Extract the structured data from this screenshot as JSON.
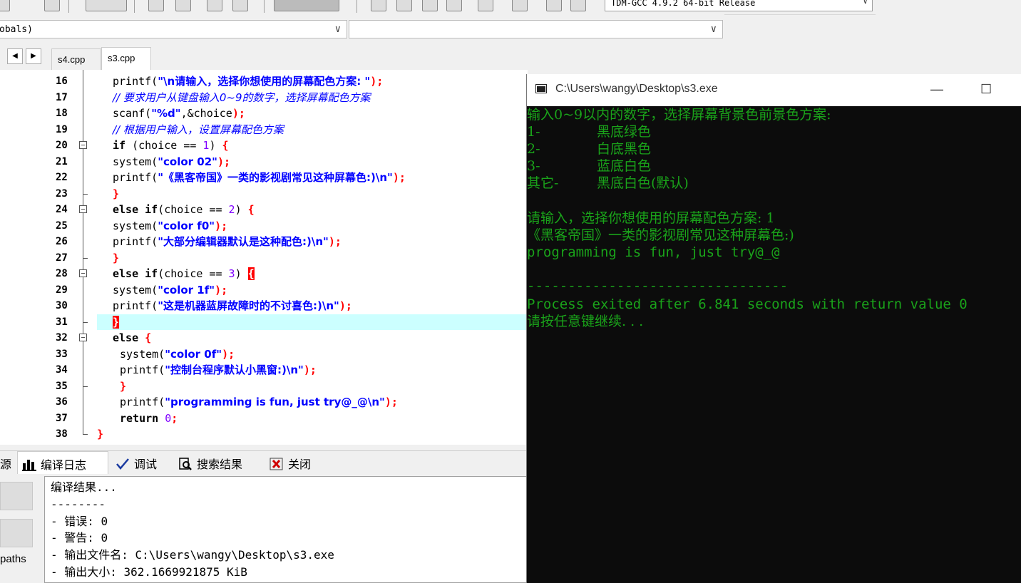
{
  "toolbar": {
    "compiler": "TDM-GCC 4.9.2 64-bit Release"
  },
  "scope": {
    "globals": "obals)",
    "members": ""
  },
  "tabs": [
    {
      "label": "s4.cpp",
      "active": false
    },
    {
      "label": "s3.cpp",
      "active": true
    }
  ],
  "editor": {
    "line_numbers": [
      "16",
      "17",
      "18",
      "19",
      "20",
      "21",
      "22",
      "23",
      "24",
      "25",
      "26",
      "27",
      "28",
      "29",
      "30",
      "31",
      "32",
      "33",
      "34",
      "35",
      "36",
      "37",
      "38"
    ],
    "lines": {
      "l16": {
        "fn": "printf(",
        "str": "\"\\n请输入，选择你想使用的屏幕配色方案: \"",
        "end": ");"
      },
      "l17": "// 要求用户从键盘输入0~9的数字，选择屏幕配色方案",
      "l18": {
        "fn": "scanf(",
        "str": "\"%d\"",
        "mid": ",&choice",
        "end": ");"
      },
      "l19": "// 根据用户输入，设置屏幕配色方案",
      "l20": {
        "kw": "if",
        "a": " (choice ",
        "op": "==",
        "num": " 1",
        "b": ") ",
        "brace": "{"
      },
      "l21": {
        "fn": "system(",
        "str": "\"color 02\"",
        "end": ");"
      },
      "l22": {
        "fn": "printf(",
        "str": "\"《黑客帝国》一类的影视剧常见这种屏幕色:)\\n\"",
        "end": ");"
      },
      "l23": "}",
      "l24": {
        "kw": "else if",
        "a": "(choice ",
        "op": "==",
        "num": " 2",
        "b": ") ",
        "brace": "{"
      },
      "l25": {
        "fn": "system(",
        "str": "\"color f0\"",
        "end": ");"
      },
      "l26": {
        "fn": "printf(",
        "str": "\"大部分编辑器默认是这种配色:)\\n\"",
        "end": ");"
      },
      "l27": "}",
      "l28": {
        "kw": "else if",
        "a": "(choice ",
        "op": "==",
        "num": " 3",
        "b": ") ",
        "brace": "{"
      },
      "l29": {
        "fn": "system(",
        "str": "\"color 1f\"",
        "end": ");"
      },
      "l30": {
        "fn": "printf(",
        "str": "\"这是机器蓝屏故障时的不讨喜色:)\\n\"",
        "end": ");"
      },
      "l31": "}",
      "l32": {
        "kw": "else",
        "brace": " {"
      },
      "l33": {
        "fn": "system(",
        "str": "\"color 0f\"",
        "end": ");"
      },
      "l34": {
        "fn": "printf(",
        "str": "\"控制台程序默认小黑窗:)\\n\"",
        "end": ");"
      },
      "l35": "}",
      "l36": {
        "fn": "printf(",
        "str": "\"programming is fun, just try@_@\\n\"",
        "end": ");"
      },
      "l37": {
        "kw": "return",
        "num": " 0",
        "end": ";"
      },
      "l38": "}"
    }
  },
  "bottom_tabs": [
    {
      "label": "源",
      "icon": "resources-icon"
    },
    {
      "label": "编译日志",
      "icon": "bar-chart-icon"
    },
    {
      "label": "调试",
      "icon": "checkmark-icon"
    },
    {
      "label": "搜索结果",
      "icon": "search-document-icon"
    },
    {
      "label": "关闭",
      "icon": "close-icon"
    }
  ],
  "log": {
    "lines": [
      "编译结果...",
      "--------",
      "- 错误: 0",
      "- 警告: 0",
      "- 输出文件名: C:\\Users\\wangy\\Desktop\\s3.exe",
      "- 输出大小: 362.1669921875 KiB"
    ],
    "paths_label": "paths"
  },
  "console": {
    "title": "C:\\Users\\wangy\\Desktop\\s3.exe",
    "minimize": "—",
    "maximize": "☐",
    "prompt_menu": "输入0~9以内的数字，选择屏幕背景色前景色方案:",
    "options": [
      {
        "key": "1-",
        "desc": "黑底绿色"
      },
      {
        "key": "2-",
        "desc": "白底黑色"
      },
      {
        "key": "3-",
        "desc": "蓝底白色"
      },
      {
        "key": "其它-",
        "desc": "黑底白色(默认)"
      }
    ],
    "input_line": "请输入，选择你想使用的屏幕配色方案: 1",
    "output_line": "《黑客帝国》一类的影视剧常见这种屏幕色:)",
    "fun_line": "programming is fun, just try@_@",
    "separator": "--------------------------------",
    "exit_line": "Process exited after 6.841 seconds with return value 0",
    "continue_line": "请按任意键继续. . ."
  },
  "colors": {
    "console_bg": "#0c0c0c",
    "console_fg": "#1aa31a",
    "active_line": "#ccffff",
    "string": "#0000ff",
    "number": "#8000ff",
    "symbol": "#ff0000"
  }
}
